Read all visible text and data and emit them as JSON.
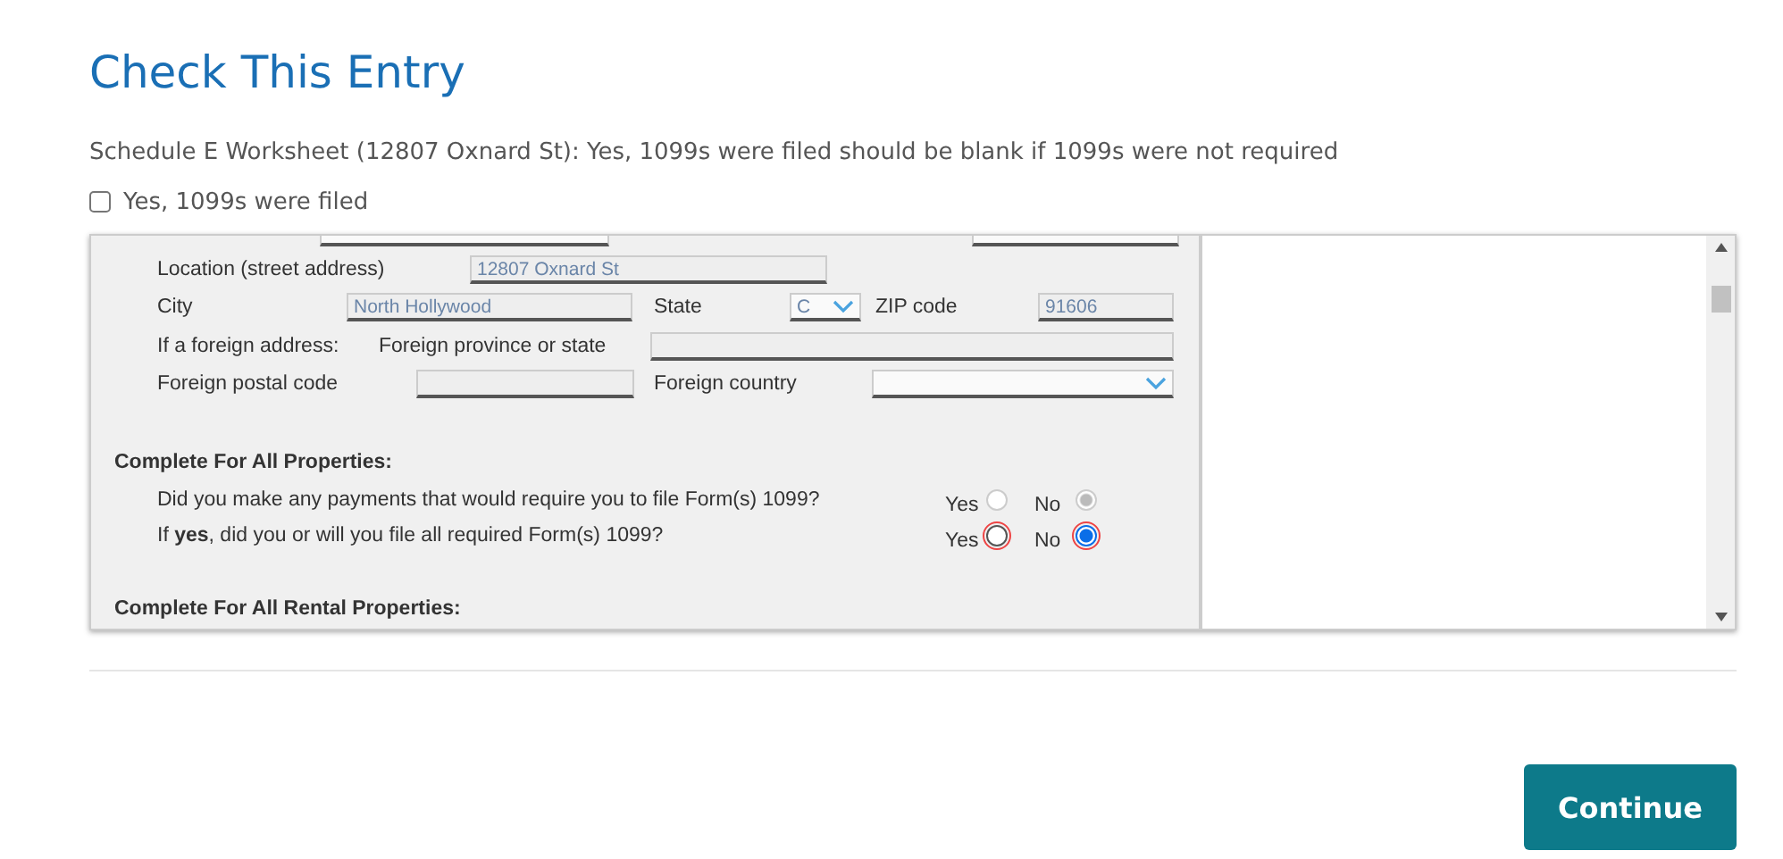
{
  "title": "Check This Entry",
  "message": "Schedule E Worksheet (12807 Oxnard St): Yes, 1099s were filed should be blank if 1099s were not required",
  "confirm": {
    "label": "Yes, 1099s were filed",
    "checked": false
  },
  "form": {
    "location": {
      "label": "Location (street address)",
      "value": "12807 Oxnard St"
    },
    "city": {
      "label": "City",
      "value": "North Hollywood"
    },
    "state": {
      "label": "State",
      "value": "C"
    },
    "zip": {
      "label": "ZIP code",
      "value": "91606"
    },
    "foreign_address": {
      "label": "If a foreign address:",
      "province_label": "Foreign province or state"
    },
    "foreign_postal": {
      "label": "Foreign postal code"
    },
    "foreign_country": {
      "label": "Foreign country"
    },
    "sections": [
      {
        "heading": "Complete For All Properties:",
        "questions": [
          {
            "text": "Did you make any payments that would require you to file Form(s) 1099?",
            "disabled": true,
            "flagged": false,
            "options": [
              {
                "label": "Yes",
                "selected": false
              },
              {
                "label": "No",
                "selected": true
              }
            ]
          },
          {
            "text": "If **yes**, did you or will you file all required Form(s) 1099?",
            "disabled": false,
            "flagged": true,
            "options": [
              {
                "label": "Yes",
                "selected": false
              },
              {
                "label": "No",
                "selected": true
              }
            ]
          }
        ]
      },
      {
        "heading": "Complete For All Rental Properties:"
      }
    ]
  },
  "button": "Continue"
}
